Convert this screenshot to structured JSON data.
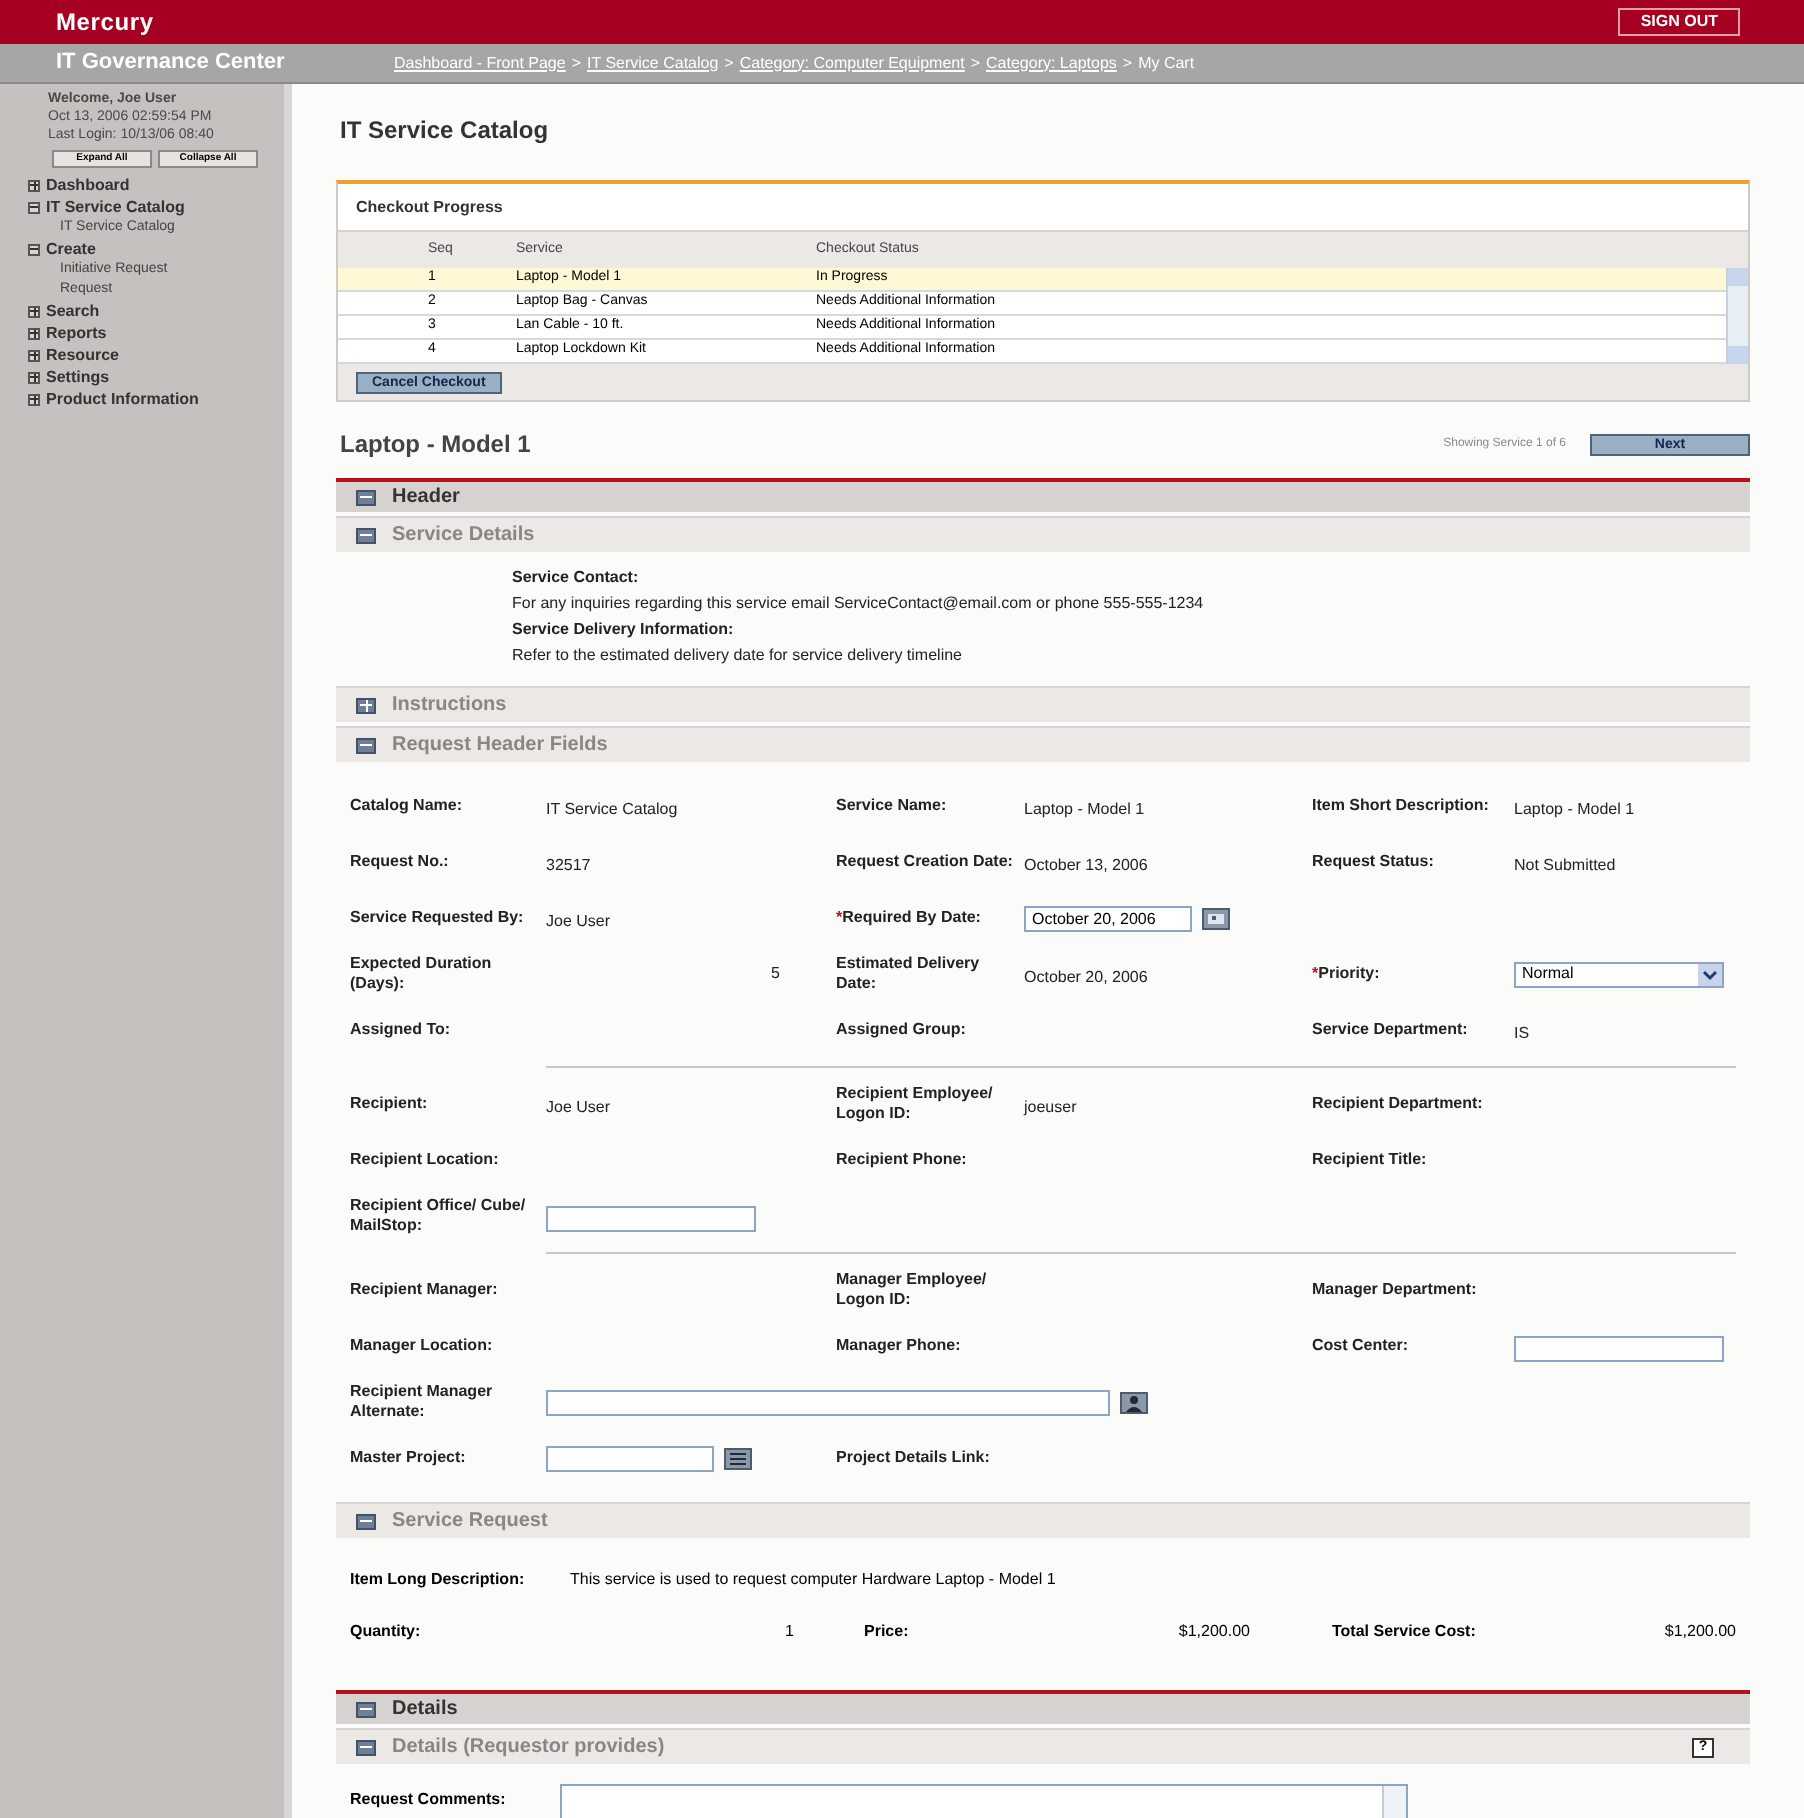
{
  "brand": {
    "logo": "Mercury",
    "sign_out": "SIGN OUT",
    "app_title": "IT Governance Center"
  },
  "breadcrumb": {
    "separator": ">",
    "items": [
      {
        "label": "Dashboard - Front Page",
        "kind": "link"
      },
      {
        "label": "IT Service Catalog",
        "kind": "link"
      },
      {
        "label": "Category: Computer Equipment",
        "kind": "link"
      },
      {
        "label": "Category: Laptops",
        "kind": "link"
      },
      {
        "label": "My Cart",
        "kind": "current"
      }
    ]
  },
  "sidebar": {
    "welcome": "Welcome, Joe User",
    "datetime": "Oct 13, 2006 02:59:54 PM",
    "last_login": "Last Login: 10/13/06 08:40",
    "expand_all": "Expand All",
    "collapse_all": "Collapse All",
    "items": [
      {
        "label": "Dashboard",
        "expanded": false
      },
      {
        "label": "IT Service Catalog",
        "expanded": true,
        "children": [
          {
            "label": "IT Service Catalog"
          }
        ]
      },
      {
        "label": "Create",
        "expanded": true,
        "children": [
          {
            "label": "Initiative Request"
          },
          {
            "label": "Request"
          }
        ]
      },
      {
        "label": "Search",
        "expanded": false
      },
      {
        "label": "Reports",
        "expanded": false
      },
      {
        "label": "Resource",
        "expanded": false
      },
      {
        "label": "Settings",
        "expanded": false
      },
      {
        "label": "Product Information",
        "expanded": false
      }
    ]
  },
  "required_mark": "*",
  "page_title": "IT Service Catalog",
  "checkout": {
    "title": "Checkout Progress",
    "columns": [
      "Seq",
      "Service",
      "Checkout Status"
    ],
    "rows": [
      {
        "seq": "1",
        "service": "Laptop - Model 1",
        "status": "In Progress",
        "selected": true
      },
      {
        "seq": "2",
        "service": "Laptop Bag - Canvas",
        "status": "Needs Additional Information",
        "selected": false
      },
      {
        "seq": "3",
        "service": "Lan Cable - 10 ft.",
        "status": "Needs Additional Information",
        "selected": false
      },
      {
        "seq": "4",
        "service": "Laptop Lockdown Kit",
        "status": "Needs Additional Information",
        "selected": false
      }
    ],
    "cancel": "Cancel Checkout"
  },
  "service_title": "Laptop - Model 1",
  "showing": "Showing Service 1 of 6",
  "next": "Next",
  "sections": [
    {
      "kind": "major",
      "title": "Header",
      "expanded": true
    },
    {
      "kind": "minor",
      "title": "Service Details",
      "expanded": true,
      "body": {
        "kind": "info",
        "lines": [
          {
            "text": "Service Contact:",
            "kind": "heading"
          },
          {
            "text": "For any inquiries regarding this service email ServiceContact@email.com or phone 555-555-1234",
            "kind": "text"
          },
          {
            "text": "Service Delivery Information:",
            "kind": "heading"
          },
          {
            "text": "Refer to the estimated delivery date for service delivery timeline",
            "kind": "text"
          }
        ]
      }
    },
    {
      "kind": "minor",
      "title": "Instructions",
      "expanded": false
    },
    {
      "kind": "minor",
      "title": "Request Header Fields",
      "expanded": true,
      "body": {
        "kind": "fields",
        "rows": [
          {
            "kind": "fields",
            "cells": [
              {
                "label": "Catalog Name:",
                "kind": "text",
                "value": "IT Service Catalog"
              },
              {
                "label": "Service Name:",
                "kind": "text",
                "value": "Laptop - Model 1"
              },
              {
                "label": "Item Short Description:",
                "kind": "text",
                "value": "Laptop - Model 1"
              }
            ]
          },
          {
            "kind": "fields",
            "cells": [
              {
                "label": "Request No.:",
                "kind": "text",
                "value": "32517"
              },
              {
                "label": "Request Creation Date:",
                "kind": "text",
                "value": "October 13, 2006"
              },
              {
                "label": "Request Status:",
                "kind": "text",
                "value": "Not Submitted"
              }
            ]
          },
          {
            "kind": "fields",
            "cells": [
              {
                "label": "Service Requested By:",
                "kind": "text",
                "value": "Joe User"
              },
              {
                "label": "Required By Date:",
                "required": true,
                "kind": "date",
                "value": "October 20, 2006"
              }
            ]
          },
          {
            "kind": "fields",
            "cells": [
              {
                "label": "Expected Duration (Days):",
                "kind": "number",
                "value": "5"
              },
              {
                "label": "Estimated Delivery Date:",
                "kind": "text",
                "value": "October 20, 2006"
              },
              {
                "label": "Priority:",
                "required": true,
                "kind": "select",
                "value": "Normal"
              }
            ]
          },
          {
            "kind": "fields",
            "cells": [
              {
                "label": "Assigned To:",
                "kind": "text"
              },
              {
                "label": "Assigned Group:",
                "kind": "text"
              },
              {
                "label": "Service Department:",
                "kind": "text",
                "value": "IS"
              }
            ]
          },
          {
            "kind": "divider"
          },
          {
            "kind": "fields",
            "cells": [
              {
                "label": "Recipient:",
                "kind": "text",
                "value": "Joe User"
              },
              {
                "label": "Recipient Employee/ Logon ID:",
                "kind": "text",
                "value": "joeuser"
              },
              {
                "label": "Recipient Department:",
                "kind": "text"
              }
            ]
          },
          {
            "kind": "fields",
            "cells": [
              {
                "label": "Recipient Location:",
                "kind": "text"
              },
              {
                "label": "Recipient Phone:",
                "kind": "text"
              },
              {
                "label": "Recipient Title:",
                "kind": "text"
              }
            ]
          },
          {
            "kind": "fields",
            "cells": [
              {
                "label": "Recipient Office/ Cube/ MailStop:",
                "kind": "input"
              }
            ]
          },
          {
            "kind": "divider"
          },
          {
            "kind": "fields",
            "cells": [
              {
                "label": "Recipient Manager:",
                "kind": "text"
              },
              {
                "label": "Manager Employee/ Logon ID:",
                "kind": "text"
              },
              {
                "label": "Manager Department:",
                "kind": "text"
              }
            ]
          },
          {
            "kind": "fields",
            "cells": [
              {
                "label": "Manager Location:",
                "kind": "text"
              },
              {
                "label": "Manager Phone:",
                "kind": "text"
              },
              {
                "label": "Cost Center:",
                "kind": "input"
              }
            ]
          },
          {
            "kind": "fields",
            "cells": [
              {
                "label": "Recipient Manager Alternate:",
                "kind": "person_wide"
              }
            ]
          },
          {
            "kind": "fields",
            "cells": [
              {
                "label": "Master Project:",
                "kind": "list_lookup"
              },
              {
                "label": "Project Details Link:",
                "kind": "text"
              }
            ]
          }
        ]
      }
    },
    {
      "kind": "minor",
      "title": "Service Request",
      "expanded": true,
      "body": {
        "kind": "request",
        "description_label": "Item Long Description:",
        "description": "This service is used to request computer Hardware Laptop - Model 1",
        "cells": [
          {
            "label": "Quantity:",
            "value": "1"
          },
          {
            "label": "Price:",
            "value": "$1,200.00"
          },
          {
            "label": "Total Service Cost:",
            "value": "$1,200.00"
          }
        ]
      }
    },
    {
      "kind": "major",
      "title": "Details",
      "expanded": true
    },
    {
      "kind": "minor",
      "title": "Details (Requestor provides)",
      "expanded": true,
      "help": "?",
      "body": {
        "kind": "comments",
        "label": "Request Comments:"
      }
    }
  ]
}
